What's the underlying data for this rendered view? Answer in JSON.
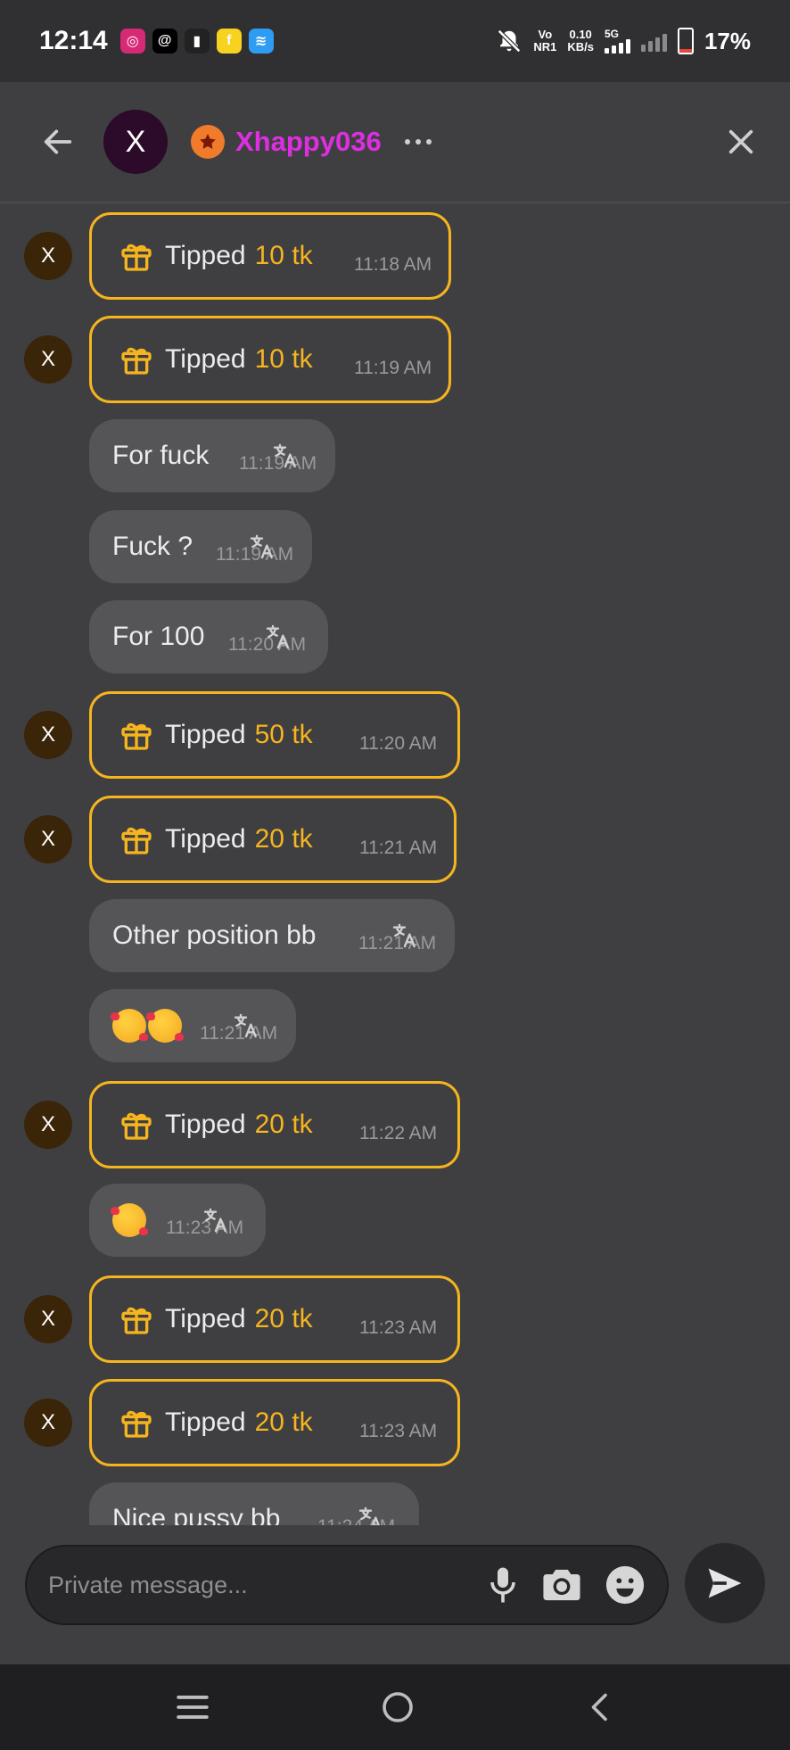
{
  "status_bar": {
    "time": "12:14",
    "app_icons": [
      {
        "name": "instagram-icon",
        "glyph": "◎",
        "color": "#d62976"
      },
      {
        "name": "threads-icon",
        "glyph": "@",
        "color": "#000000"
      },
      {
        "name": "sim-icon",
        "glyph": "▮",
        "color": "#222222"
      },
      {
        "name": "flipkart-icon",
        "glyph": "f",
        "color": "#f7d21e"
      },
      {
        "name": "app-icon",
        "glyph": "≋",
        "color": "#2f9cf4"
      }
    ],
    "volte_top": "Vo",
    "volte_bottom": "NR1",
    "speed_value": "0.10",
    "speed_unit": "KB/s",
    "network_type": "5G",
    "battery": "17%",
    "battery_level": 0.17,
    "battery_color": "#e8453c"
  },
  "header": {
    "avatar_initial": "X",
    "username": "Xhappy036",
    "username_color": "#df2ee2",
    "badge_color": "#ef7b2b"
  },
  "messages": [
    {
      "type": "tip",
      "label": "Tipped",
      "amount": "10 tk",
      "time": "11:18 AM",
      "avatar": "X"
    },
    {
      "type": "tip",
      "label": "Tipped",
      "amount": "10 tk",
      "time": "11:19 AM",
      "avatar": "X"
    },
    {
      "type": "text",
      "text": "For fuck",
      "time": "11:19 AM"
    },
    {
      "type": "text",
      "text": "Fuck ?",
      "time": "11:19 AM"
    },
    {
      "type": "text",
      "text": "For 100",
      "time": "11:20 AM"
    },
    {
      "type": "tip",
      "label": "Tipped",
      "amount": "50 tk",
      "time": "11:20 AM",
      "avatar": "X"
    },
    {
      "type": "tip",
      "label": "Tipped",
      "amount": "20 tk",
      "time": "11:21 AM",
      "avatar": "X"
    },
    {
      "type": "text",
      "text": "Other position bb",
      "time": "11:21 AM"
    },
    {
      "type": "emoji",
      "count": 2,
      "emoji_name": "smiling-face-with-hearts",
      "time": "11:21 AM"
    },
    {
      "type": "tip",
      "label": "Tipped",
      "amount": "20 tk",
      "time": "11:22 AM",
      "avatar": "X"
    },
    {
      "type": "emoji",
      "count": 1,
      "emoji_name": "smiling-face-with-hearts",
      "time": "11:23 AM"
    },
    {
      "type": "tip",
      "label": "Tipped",
      "amount": "20 tk",
      "time": "11:23 AM",
      "avatar": "X"
    },
    {
      "type": "tip",
      "label": "Tipped",
      "amount": "20 tk",
      "time": "11:23 AM",
      "avatar": "X"
    },
    {
      "type": "text",
      "text": "Nice pussy bb",
      "time": "11:24 AM"
    }
  ],
  "composer": {
    "placeholder": "Private message..."
  },
  "colors": {
    "tip_accent": "#f6b51e",
    "bubble_bg": "#555558",
    "background": "#3f3f42"
  }
}
